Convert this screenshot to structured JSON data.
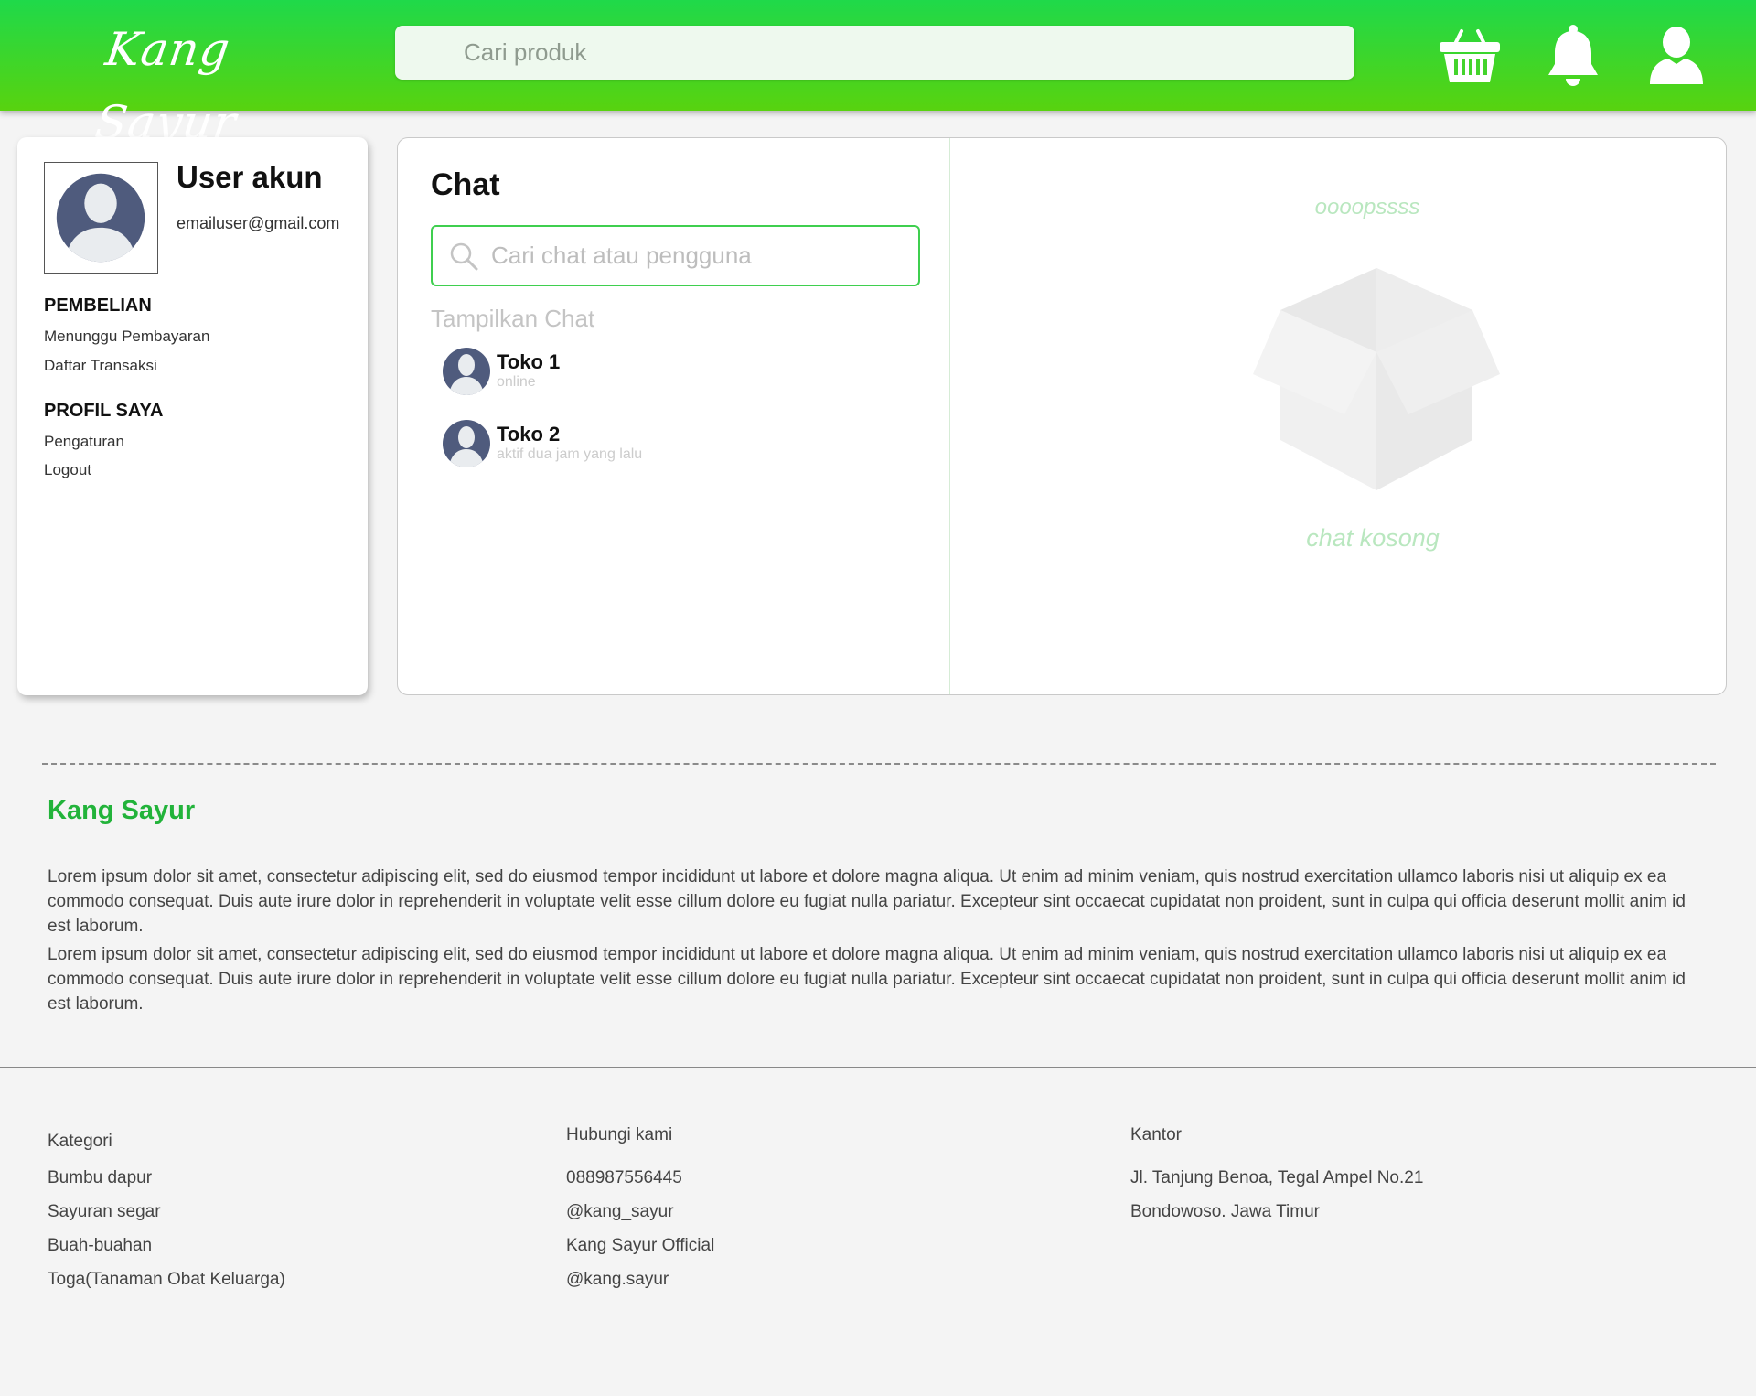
{
  "brand": {
    "name": "Kang Sayur"
  },
  "header": {
    "search_placeholder": "Cari produk",
    "icons": [
      "basket-icon",
      "bell-icon",
      "user-icon"
    ],
    "bg_colors": [
      "#1fd94a",
      "#58d30f"
    ]
  },
  "profile": {
    "name": "User akun",
    "email": "emailuser@gmail.com",
    "sections": [
      {
        "heading": "PEMBELIAN",
        "items": [
          "Menunggu Pembayaran",
          "Daftar Transaksi"
        ]
      },
      {
        "heading": "PROFIL SAYA",
        "items": [
          "Pengaturan",
          "Logout"
        ]
      }
    ]
  },
  "chat": {
    "title": "Chat",
    "search_placeholder": "Cari chat atau pengguna",
    "list_label": "Tampilkan Chat",
    "contacts": [
      {
        "name": "Toko 1",
        "status": "online"
      },
      {
        "name": "Toko 2",
        "status": "aktif dua jam yang lalu"
      }
    ],
    "empty": {
      "title": "oooopssss",
      "message": "chat kosong",
      "icon": "empty-box-icon"
    }
  },
  "about": {
    "title": "Kang Sayur",
    "paragraphs": [
      "Lorem ipsum dolor sit amet, consectetur adipiscing elit, sed do eiusmod tempor incididunt ut labore et dolore magna aliqua. Ut enim ad minim veniam, quis nostrud exercitation ullamco laboris nisi ut aliquip ex ea commodo consequat. Duis aute irure dolor in reprehenderit in voluptate velit esse cillum dolore eu fugiat nulla pariatur. Excepteur sint occaecat cupidatat non proident, sunt in culpa qui officia deserunt mollit anim id est laborum.",
      "Lorem ipsum dolor sit amet, consectetur adipiscing elit, sed do eiusmod tempor incididunt ut labore et dolore magna aliqua. Ut enim ad minim veniam, quis nostrud exercitation ullamco laboris nisi ut aliquip ex ea commodo consequat. Duis aute irure dolor in reprehenderit in voluptate velit esse cillum dolore eu fugiat nulla pariatur. Excepteur sint occaecat cupidatat non proident, sunt in culpa qui officia deserunt mollit anim id est laborum."
    ]
  },
  "footer": {
    "kategori": {
      "heading": "Kategori",
      "items": [
        "Bumbu dapur",
        "Sayuran segar",
        "Buah-buahan",
        "Toga(Tanaman Obat Keluarga)"
      ]
    },
    "hubungi": {
      "heading": "Hubungi kami",
      "items": [
        "088987556445",
        "@kang_sayur",
        "Kang Sayur Official",
        "@kang.sayur"
      ]
    },
    "kantor": {
      "heading": "Kantor",
      "items": [
        "Jl. Tanjung Benoa, Tegal Ampel No.21",
        "Bondowoso. Jawa Timur"
      ]
    }
  }
}
